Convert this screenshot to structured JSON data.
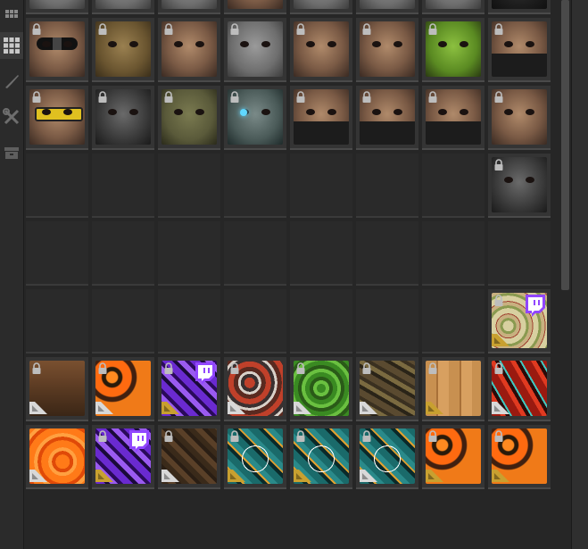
{
  "sidebar": {
    "buttons": [
      {
        "icon": "grid-small-icon"
      },
      {
        "icon": "grid-icon",
        "active": true
      },
      {
        "icon": "knife-icon"
      },
      {
        "icon": "tools-icon"
      },
      {
        "icon": "storage-box-icon"
      }
    ]
  },
  "grid": {
    "columns": 8,
    "rows": [
      {
        "cells": [
          {
            "type": "mask-grey red-nose",
            "locked": true
          },
          {
            "type": "mask-grey red-nose",
            "locked": true
          },
          {
            "type": "mask-grey red-nose",
            "locked": true
          },
          {
            "type": "face",
            "locked": true
          },
          {
            "type": "mask-grey",
            "locked": true
          },
          {
            "type": "mask-grey",
            "locked": true
          },
          {
            "type": "mask-grey",
            "locked": true
          },
          {
            "type": "mask-black",
            "locked": true
          }
        ]
      },
      {
        "cells": [
          {
            "type": "face goggles",
            "locked": true
          },
          {
            "type": "mask-sack",
            "locked": true
          },
          {
            "type": "face",
            "locked": true
          },
          {
            "type": "mask-grey",
            "locked": true
          },
          {
            "type": "face",
            "locked": true
          },
          {
            "type": "face",
            "locked": true
          },
          {
            "type": "mask-green",
            "locked": true
          },
          {
            "type": "face lower-black",
            "locked": true
          }
        ]
      },
      {
        "cells": [
          {
            "type": "face yellow-glasses",
            "locked": true
          },
          {
            "type": "mask-skull",
            "locked": true
          },
          {
            "type": "mask-camo",
            "locked": true
          },
          {
            "type": "face-robot robot-eye",
            "locked": true
          },
          {
            "type": "face lower-black",
            "locked": true
          },
          {
            "type": "face lower-black",
            "locked": true
          },
          {
            "type": "face lower-black",
            "locked": true
          },
          {
            "type": "face",
            "locked": true
          }
        ]
      },
      {
        "cells": [
          {
            "type": "empty"
          },
          {
            "type": "empty"
          },
          {
            "type": "empty"
          },
          {
            "type": "empty"
          },
          {
            "type": "empty"
          },
          {
            "type": "empty"
          },
          {
            "type": "empty"
          },
          {
            "type": "mask-skull",
            "locked": true
          }
        ]
      },
      {
        "cells": [
          {
            "type": "empty"
          },
          {
            "type": "empty"
          },
          {
            "type": "empty"
          },
          {
            "type": "empty"
          },
          {
            "type": "empty"
          },
          {
            "type": "empty"
          },
          {
            "type": "empty"
          },
          {
            "type": "empty"
          }
        ]
      },
      {
        "cells": [
          {
            "type": "empty"
          },
          {
            "type": "empty"
          },
          {
            "type": "empty"
          },
          {
            "type": "empty"
          },
          {
            "type": "empty"
          },
          {
            "type": "empty"
          },
          {
            "type": "empty"
          },
          {
            "type": "skin-map",
            "locked": true,
            "twitch": true,
            "badge": "gold"
          }
        ]
      },
      {
        "cells": [
          {
            "type": "skin-wood",
            "locked": true,
            "badge": "white"
          },
          {
            "type": "skin-lava",
            "locked": true,
            "badge": "white"
          },
          {
            "type": "skin-purple",
            "locked": true,
            "twitch": true,
            "badge": "gold"
          },
          {
            "type": "skin-redcamo",
            "locked": true,
            "badge": "white"
          },
          {
            "type": "skin-green",
            "locked": true,
            "badge": "white"
          },
          {
            "type": "skin-brcamo",
            "locked": true,
            "badge": "white"
          },
          {
            "type": "skin-planks",
            "locked": true,
            "badge": "gold"
          },
          {
            "type": "skin-redcyan",
            "locked": true,
            "badge": "white"
          }
        ]
      },
      {
        "cells": [
          {
            "type": "skin-orange",
            "locked": false,
            "badge": "white"
          },
          {
            "type": "skin-purple",
            "locked": true,
            "twitch": true,
            "badge": "gold"
          },
          {
            "type": "skin-dark",
            "locked": true,
            "badge": "white"
          },
          {
            "type": "skin-teal",
            "locked": true,
            "badge": "gold"
          },
          {
            "type": "skin-teal",
            "locked": true,
            "badge": "gold"
          },
          {
            "type": "skin-teal",
            "locked": true,
            "badge": "white"
          },
          {
            "type": "skin-lava",
            "locked": true,
            "badge": "gold"
          },
          {
            "type": "skin-lava",
            "locked": true,
            "badge": "gold"
          }
        ]
      }
    ]
  },
  "colors": {
    "background": "#262626",
    "twitch_purple": "#9146ff",
    "badge_gold": "#c8a030",
    "badge_white": "#d8d8d8"
  }
}
